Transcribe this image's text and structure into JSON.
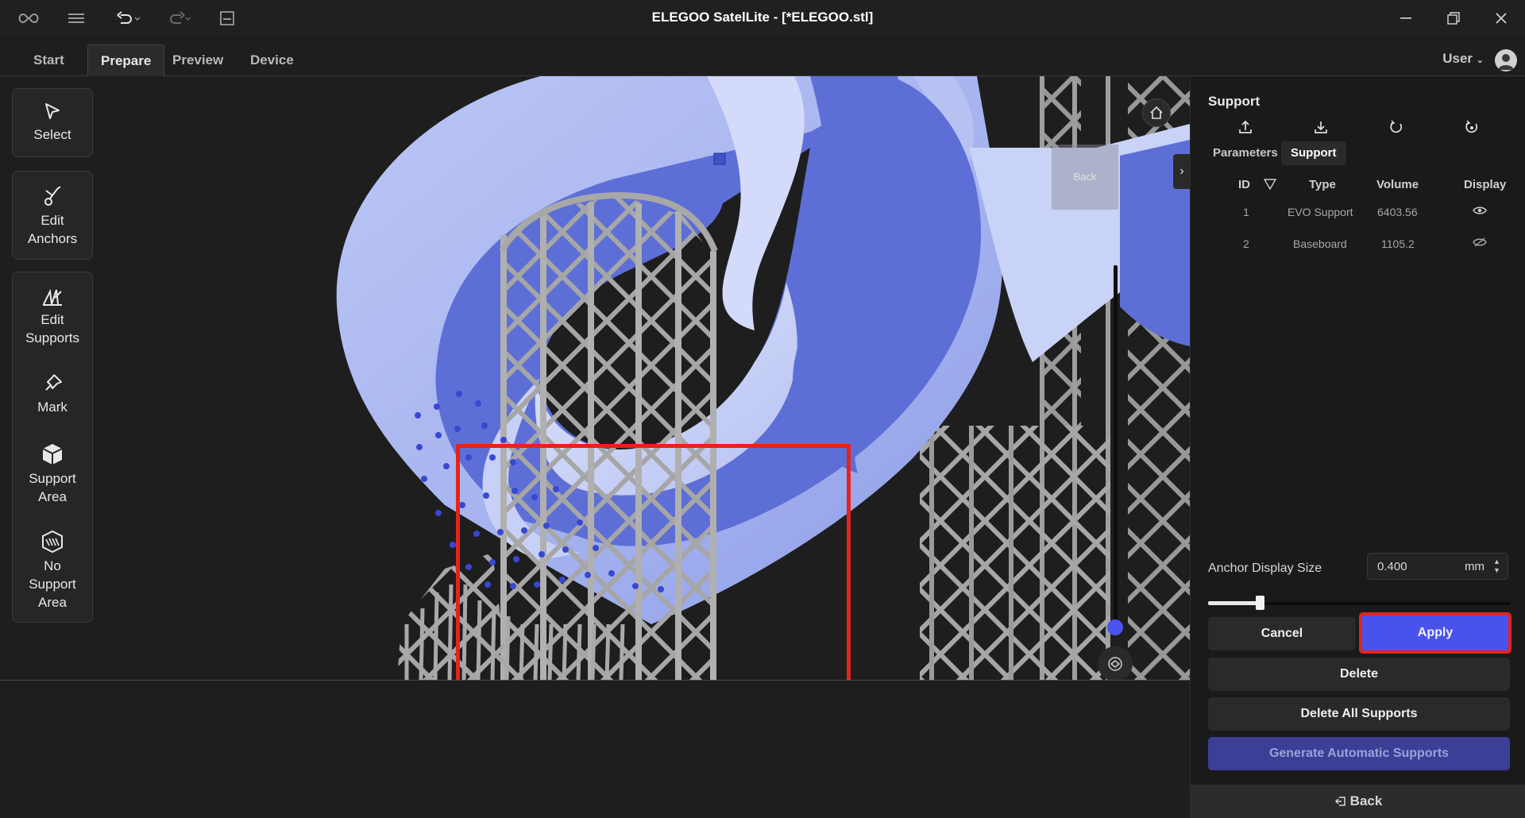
{
  "window": {
    "title": "ELEGOO SatelLite - [*ELEGOO.stl]"
  },
  "tabs": [
    {
      "label": "Start"
    },
    {
      "label": "Prepare",
      "active": true
    },
    {
      "label": "Preview"
    },
    {
      "label": "Device"
    }
  ],
  "user": {
    "label": "User"
  },
  "tools": [
    {
      "label": "Select",
      "icon": "cursor-icon"
    },
    {
      "label": "Edit Anchors",
      "icon": "edit-anchor-icon"
    },
    {
      "label": "Edit Supports",
      "icon": "support-icon"
    },
    {
      "label": "Mark",
      "icon": "pin-icon"
    },
    {
      "label": "Support Area",
      "icon": "cube-icon"
    },
    {
      "label": "No Support Area",
      "icon": "no-support-icon"
    }
  ],
  "viewport": {
    "back_label": "Back"
  },
  "panel": {
    "title": "Support",
    "subtabs": [
      "Parameters",
      "Support"
    ],
    "active_subtab": "Support",
    "table": {
      "headers": [
        "ID",
        "Type",
        "Volume",
        "Display"
      ],
      "rows": [
        {
          "id": "1",
          "type": "EVO Support",
          "volume": "6403.56",
          "display": "visible"
        },
        {
          "id": "2",
          "type": "Baseboard",
          "volume": "1105.2",
          "display": "hidden"
        }
      ]
    },
    "anchor_display_size": {
      "label": "Anchor Display Size",
      "value": "0.400",
      "unit": "mm"
    },
    "buttons": {
      "cancel": "Cancel",
      "apply": "Apply",
      "delete": "Delete",
      "delete_all": "Delete All Supports",
      "generate": "Generate Automatic Supports"
    },
    "back_label": "Back"
  },
  "colors": {
    "accent": "#4a52ec",
    "highlight": "#e5231b",
    "model": "#5d6fd6",
    "background": "#1e1e1e"
  }
}
